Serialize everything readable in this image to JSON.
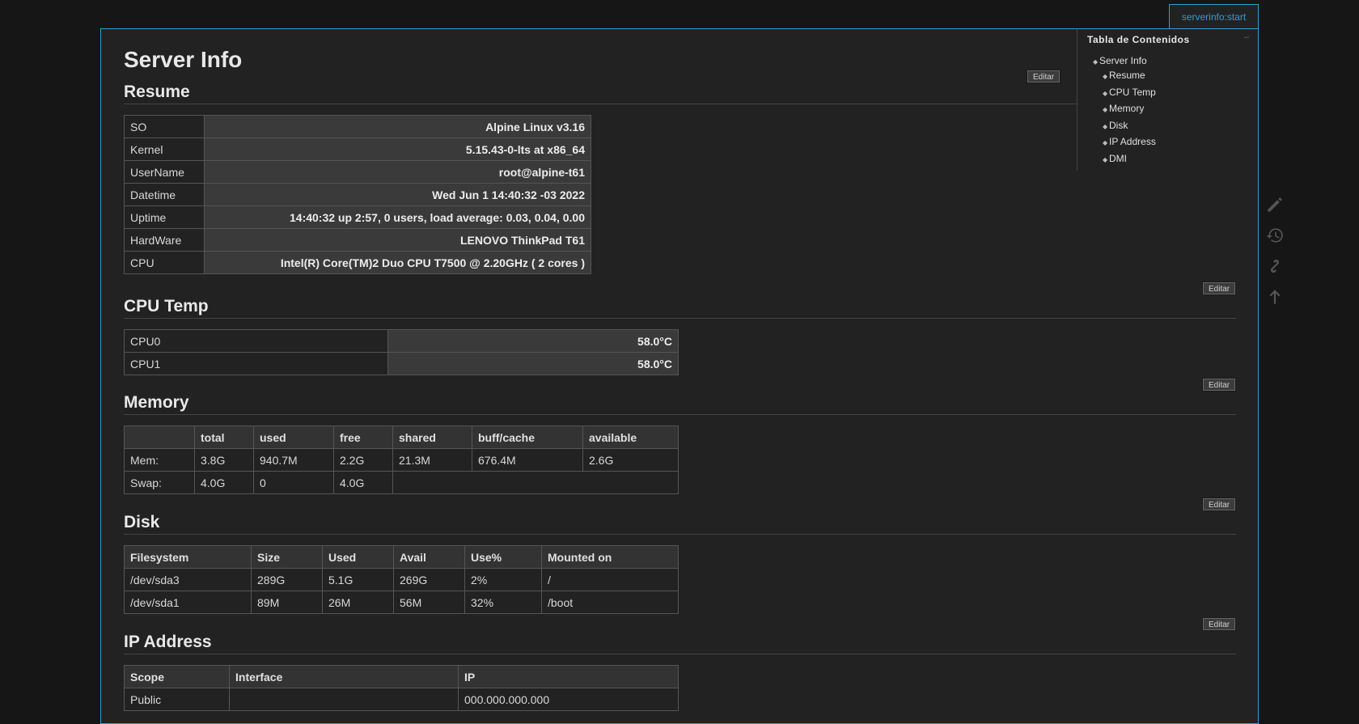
{
  "tab": {
    "label": "serverinfo:start"
  },
  "page": {
    "title": "Server Info",
    "edit_label": "Editar"
  },
  "toc": {
    "title": "Tabla de Contenidos",
    "items": [
      {
        "label": "Server Info"
      },
      {
        "label": "Resume"
      },
      {
        "label": "CPU Temp"
      },
      {
        "label": "Memory"
      },
      {
        "label": "Disk"
      },
      {
        "label": "IP Address"
      },
      {
        "label": "DMI"
      }
    ]
  },
  "resume": {
    "heading": "Resume",
    "rows": [
      {
        "key": "SO",
        "value": "Alpine Linux v3.16"
      },
      {
        "key": "Kernel",
        "value": "5.15.43-0-lts at x86_64"
      },
      {
        "key": "UserName",
        "value": "root@alpine-t61"
      },
      {
        "key": "Datetime",
        "value": "Wed Jun 1 14:40:32 -03 2022"
      },
      {
        "key": "Uptime",
        "value": "14:40:32 up 2:57, 0 users, load average: 0.03, 0.04, 0.00"
      },
      {
        "key": "HardWare",
        "value": "LENOVO ThinkPad T61"
      },
      {
        "key": "CPU",
        "value": "Intel(R) Core(TM)2 Duo CPU T7500 @ 2.20GHz ( 2 cores )"
      }
    ]
  },
  "cpu_temp": {
    "heading": "CPU Temp",
    "rows": [
      {
        "key": "CPU0",
        "value": "58.0°C"
      },
      {
        "key": "CPU1",
        "value": "58.0°C"
      }
    ]
  },
  "memory": {
    "heading": "Memory",
    "headers": [
      "",
      "total",
      "used",
      "free",
      "shared",
      "buff/cache",
      "available"
    ],
    "rows": [
      [
        "Mem:",
        "3.8G",
        "940.7M",
        "2.2G",
        "21.3M",
        "676.4M",
        "2.6G"
      ],
      [
        "Swap:",
        "4.0G",
        "0",
        "4.0G"
      ]
    ]
  },
  "disk": {
    "heading": "Disk",
    "headers": [
      "Filesystem",
      "Size",
      "Used",
      "Avail",
      "Use%",
      "Mounted on"
    ],
    "rows": [
      [
        "/dev/sda3",
        "289G",
        "5.1G",
        "269G",
        "2%",
        "/"
      ],
      [
        "/dev/sda1",
        "89M",
        "26M",
        "56M",
        "32%",
        "/boot"
      ]
    ]
  },
  "ip": {
    "heading": "IP Address",
    "headers": [
      "Scope",
      "Interface",
      "IP"
    ],
    "rows": [
      [
        "Public",
        "",
        "000.000.000.000"
      ]
    ]
  },
  "side_tools": [
    "pencil-icon",
    "history-icon",
    "link-icon",
    "arrow-up-icon"
  ]
}
